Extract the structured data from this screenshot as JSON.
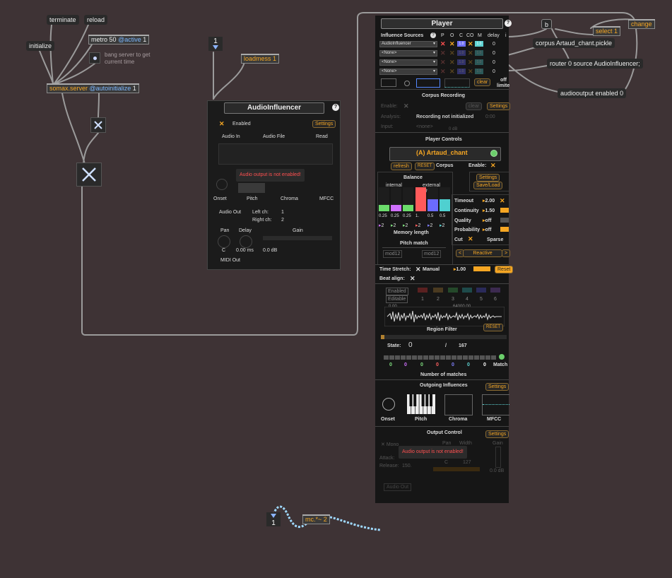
{
  "patcher": {
    "messages": {
      "terminate": "terminate",
      "reload": "reload",
      "initialize": "initialize",
      "corpus": "corpus Artaud_chant.pickle",
      "router": "router 0 source AudioInfluencer;",
      "audiooutput": "audiooutput enabled 0",
      "b": "b",
      "change": "change"
    },
    "objects": {
      "metro_name": "metro",
      "metro_args": "50",
      "metro_attr": "@active",
      "metro_attr_val": "1",
      "server_name": "somax.server",
      "server_attr": "@autoinitialize",
      "server_attr_val": "1",
      "loadmess": "loadmess 1",
      "select": "select 1",
      "mc": "mc.*~ 2"
    },
    "comment_bang": "bang server to get current time",
    "number_top": "1",
    "number_bottom": "1"
  },
  "audio_influencer": {
    "title": "AudioInfluencer",
    "help": "?",
    "enabled_label": "Enabled",
    "settings": "Settings",
    "audio_in": "Audio In",
    "audio_file": "Audio File",
    "read": "Read",
    "warning": "Audio output is not enabled!",
    "features": [
      "Onset",
      "Pitch",
      "Chroma",
      "MFCC"
    ],
    "audio_out": "Audio Out",
    "left_ch": "Left ch:",
    "left_ch_val": "1",
    "right_ch": "Right ch:",
    "right_ch_val": "2",
    "pan": "Pan",
    "pan_val": "C",
    "delay": "Delay",
    "delay_val": "0.00 ms",
    "gain": "Gain",
    "gain_val": "0.0 dB",
    "midi_out": "MIDI Out"
  },
  "player": {
    "title": "Player",
    "help": "?",
    "influence_sources_label": "Influence Sources",
    "col_headers": [
      "P",
      "O",
      "C",
      "CO",
      "M",
      "delay",
      "i"
    ],
    "sources": [
      {
        "name": "AudioInfluencer",
        "c_val": "1.0",
        "m_val": "1.0",
        "delay": "0"
      },
      {
        "name": "<None>",
        "c_val": "1.0",
        "m_val": "1.0",
        "delay": "0"
      },
      {
        "name": "<None>",
        "c_val": "1.0",
        "m_val": "1.0",
        "delay": "0"
      },
      {
        "name": "<None>",
        "c_val": "1.0",
        "m_val": "1.0",
        "delay": "0"
      }
    ],
    "clear": "clear",
    "off": "off",
    "limiter": "limite",
    "corpus_recording": "Corpus Recording",
    "enable": "Enable:",
    "rec_clear": "clear",
    "rec_settings": "Settings",
    "analysis": "Analysis:",
    "analysis_status": "Recording not initialized",
    "analysis_time": "0:00",
    "input": "Input:",
    "input_dropdown": "<none>",
    "input_db": "0 dB",
    "player_controls": "Player Controls",
    "corpus_name": "(A) Artaud_chant",
    "refresh": "refresh",
    "reset": "RESET",
    "corpus_label": "Corpus",
    "enable_label": "Enable:",
    "balance": "Balance",
    "internal": "internal",
    "external": "external",
    "balance_cols": [
      "mel",
      "harm",
      "mfcc",
      "mel",
      "harm",
      "mfcc"
    ],
    "balance_values": [
      "0.25",
      "0.25",
      "0.25",
      "1.",
      "0.5",
      "0.5"
    ],
    "balance_levels": [
      0.25,
      0.25,
      0.25,
      1.0,
      0.5,
      0.5
    ],
    "memory_vals": [
      "2",
      "2",
      "2",
      "2",
      "2",
      "2"
    ],
    "memory_length": "Memory length",
    "pitch_match": "Pitch match",
    "mod12_a": "mod12",
    "mod12_b": "mod12",
    "settings": "Settings",
    "saveload": "Save/Load",
    "params": [
      {
        "name": "Timeout",
        "val": "2.00"
      },
      {
        "name": "Continuity",
        "val": "1.50"
      },
      {
        "name": "Quality",
        "val": "off"
      },
      {
        "name": "Probability",
        "val": "off"
      }
    ],
    "cut": "Cut",
    "sparse": "Sparse",
    "mode_prev": "<",
    "mode": "Reactive",
    "mode_next": ">",
    "time_stretch": "Time Stretch:",
    "manual": "Manual",
    "ts_val": "1.00",
    "ts_reset": "Reset",
    "beat_align": "Beat align:",
    "enabled_btn": "Enabled",
    "editable_btn": "Editable",
    "region_nums": [
      "1",
      "2",
      "3",
      "4",
      "5",
      "6"
    ],
    "wave_start": "0.00",
    "wave_end": "64000.00",
    "region_filter": "Region Filter",
    "region_reset": "RESET",
    "state_label": "State:",
    "state_val": "0",
    "state_sep": "/",
    "state_total": "167",
    "match_vals": [
      "0",
      "0",
      "0",
      "0",
      "0",
      "0",
      "0"
    ],
    "match_label": "Match",
    "number_of_matches": "Number of matches",
    "outgoing_influences": "Outgoing Influences",
    "out_settings": "Settings",
    "out_features": [
      "Onset",
      "Pitch",
      "Chroma",
      "MFCC"
    ],
    "output_control": "Output Control",
    "output_settings": "Settings",
    "mono": "Mono",
    "pan": "Pan",
    "width": "Width",
    "gain": "Gain",
    "attack": "Attack:",
    "release": "Release:",
    "release_val": "150.",
    "pan_val": "C",
    "width_val": "127",
    "gain_val": "0.0 dB",
    "warning": "Audio output is not enabled!",
    "audio_out": "Audio Out"
  },
  "colors": {
    "background": "#3e3335",
    "accent_orange": "#f5a623",
    "attr_blue": "#7cb7ff",
    "warning_red": "#ff5050"
  }
}
